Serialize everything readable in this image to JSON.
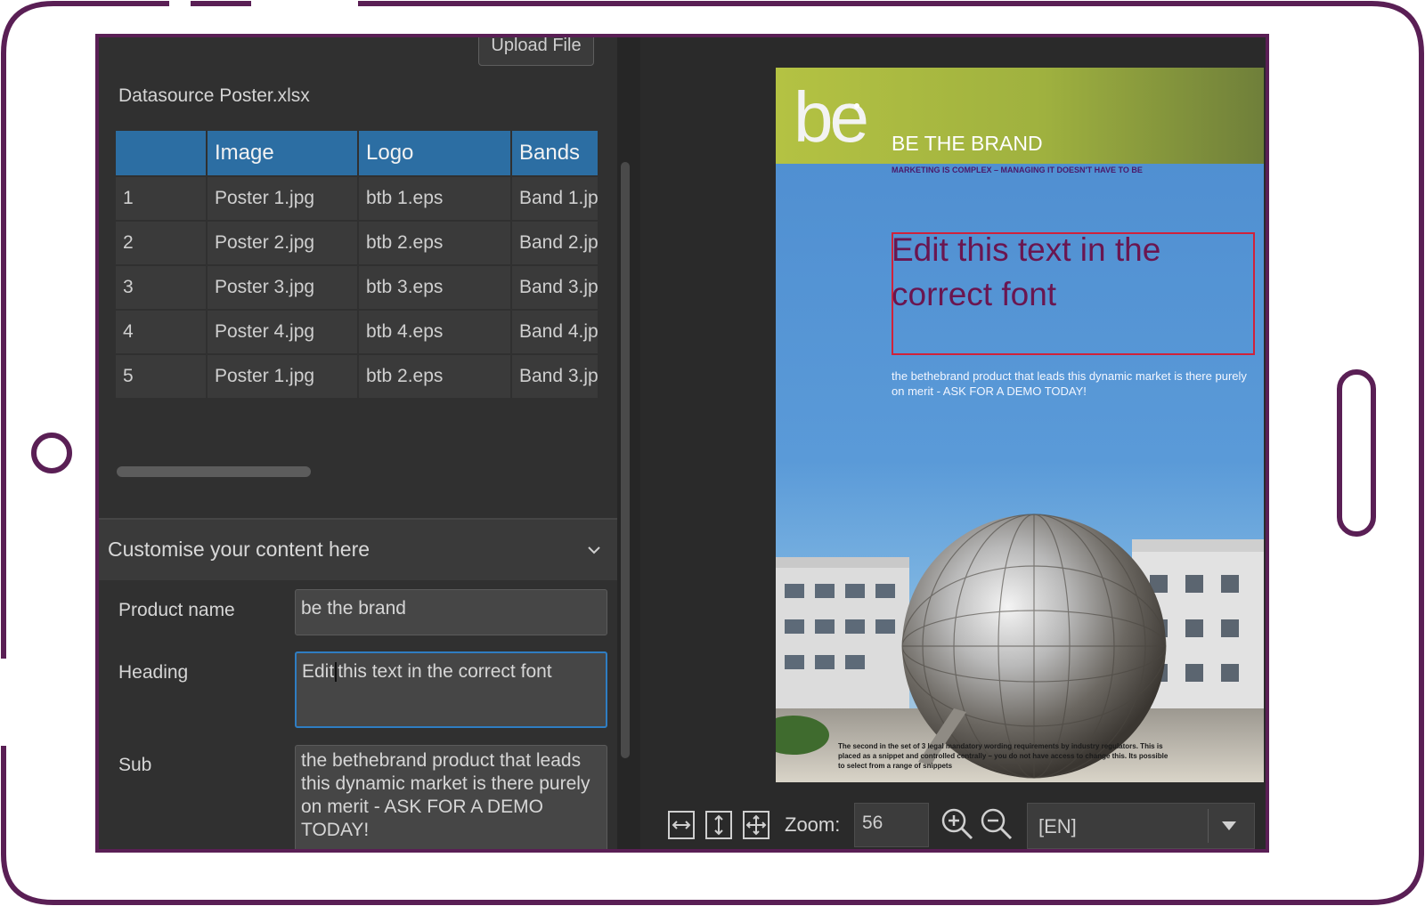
{
  "datasource": {
    "upload_label": "Upload File",
    "title": "Datasource Poster.xlsx",
    "columns": [
      "",
      "Image",
      "Logo",
      "Bands"
    ],
    "rows": [
      [
        "1",
        "Poster 1.jpg",
        "btb 1.eps",
        "Band 1.jp"
      ],
      [
        "2",
        "Poster 2.jpg",
        "btb 2.eps",
        "Band 2.jp"
      ],
      [
        "3",
        "Poster 3.jpg",
        "btb 3.eps",
        "Band 3.jp"
      ],
      [
        "4",
        "Poster 4.jpg",
        "btb 4.eps",
        "Band 4.jp"
      ],
      [
        "5",
        "Poster 1.jpg",
        "btb 2.eps",
        "Band 3.jp"
      ]
    ]
  },
  "customise": {
    "title": "Customise your content here",
    "fields": {
      "product_name_label": "Product name",
      "product_name_value": "be the brand",
      "heading_label": "Heading",
      "heading_value_before_caret": "Edit",
      "heading_value_after_caret": "this text in the correct font",
      "sub_label": "Sub",
      "sub_value": "the bethebrand product that leads this dynamic market is there purely on merit - ASK FOR A DEMO TODAY!"
    }
  },
  "poster": {
    "logo_text": "be",
    "brand": "BE THE BRAND",
    "tagline": "MARKETING IS COMPLEX – MANAGING IT DOESN'T HAVE TO BE",
    "heading": "Edit this text in the correct font",
    "sub": "the bethebrand product that leads this dynamic market is there purely on merit - ASK FOR A DEMO TODAY!",
    "footer": "The second in the set of 3 legal mandatory wording requirements by industry regulators. This is placed as a snippet and controlled centrally – you do not have access to change this. Its possible to select from a range of snippets"
  },
  "toolbar": {
    "zoom_label": "Zoom:",
    "zoom_value": "56",
    "language_value": "[EN]"
  },
  "colors": {
    "frame": "#5a1f55",
    "table_header": "#2c6ea3",
    "focus_border": "#2f7dc2",
    "poster_heading": "#6a1650",
    "heading_box": "#d0223a"
  }
}
